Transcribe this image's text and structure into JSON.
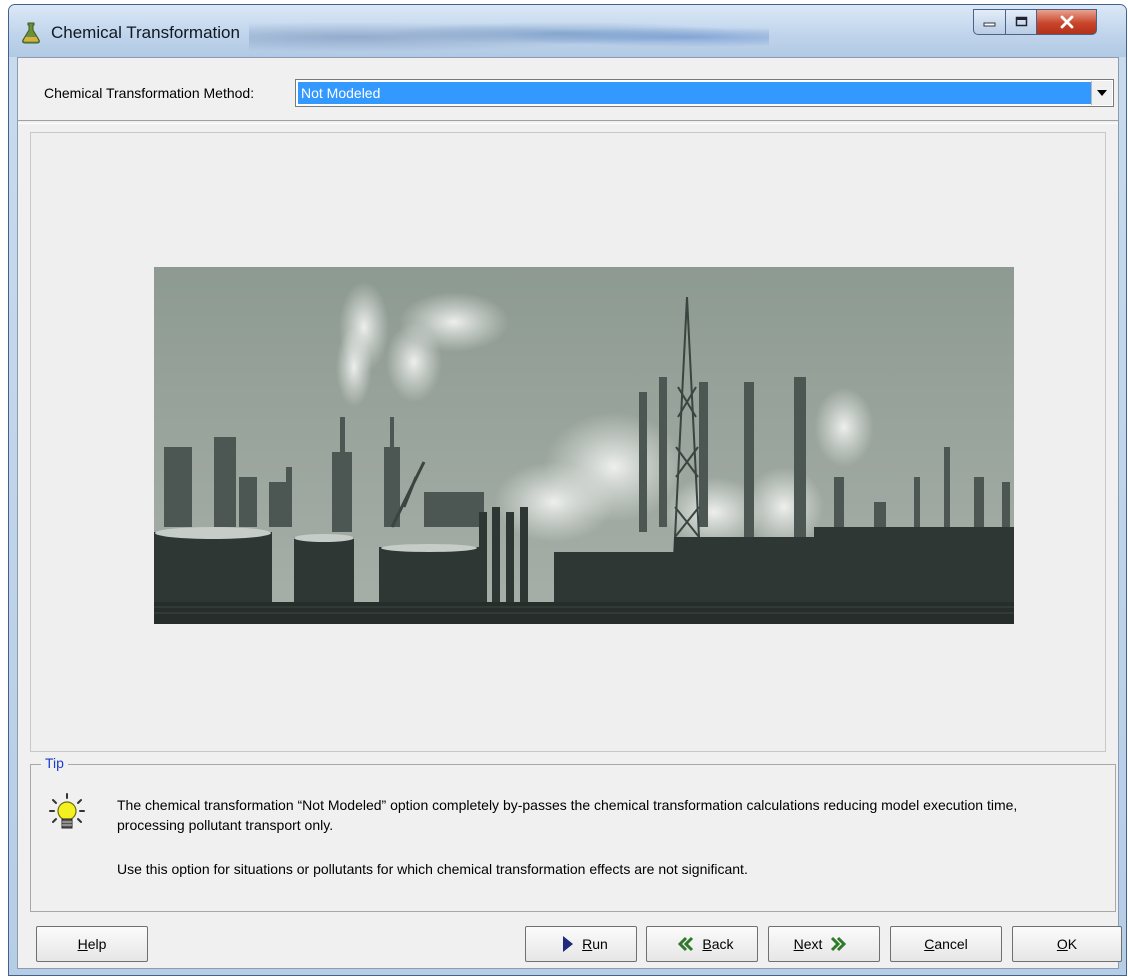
{
  "window": {
    "title": "Chemical Transformation",
    "icon": "chemistry-flask-icon"
  },
  "window_controls": {
    "minimize_icon": "minimize-icon",
    "maximize_icon": "maximize-icon",
    "close_icon": "close-icon"
  },
  "method": {
    "label": "Chemical Transformation Method:",
    "selected": "Not Modeled",
    "dropdown_icon": "chevron-down-icon"
  },
  "image": {
    "subject": "industrial-refinery-photo"
  },
  "tip": {
    "legend": "Tip",
    "icon": "lightbulb-icon",
    "line1": "The chemical transformation “Not Modeled” option completely by-passes the chemical transformation calculations reducing model execution time, processing pollutant transport only.",
    "line2": "Use this option for situations or pollutants for which chemical transformation effects are not significant."
  },
  "buttons": {
    "help": {
      "hotkey": "H",
      "rest": "elp"
    },
    "run": {
      "hotkey": "R",
      "rest": "un",
      "icon": "play-icon"
    },
    "back": {
      "hotkey": "B",
      "rest": "ack",
      "icon": "double-chevron-left-icon"
    },
    "next": {
      "hotkey": "N",
      "rest": "ext",
      "icon": "double-chevron-right-icon"
    },
    "cancel": {
      "hotkey": "C",
      "rest": "ancel"
    },
    "ok": {
      "hotkey": "O",
      "rest": "K"
    }
  },
  "colors": {
    "selection": "#3399ff",
    "tip_legend": "#1a3cc8",
    "dialog_bg": "#f0f0f0"
  }
}
